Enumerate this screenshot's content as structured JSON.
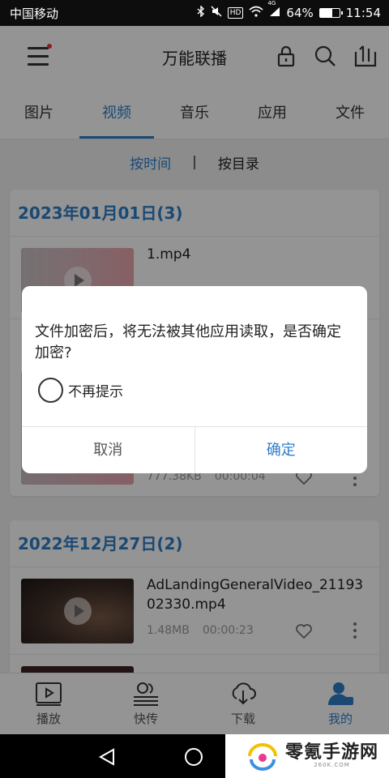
{
  "status_bar": {
    "carrier": "中国移动",
    "network_badge": "HD",
    "signal_label": "4G",
    "battery_percent": "64%",
    "battery_level": 0.64,
    "time": "11:54",
    "icons": [
      "bluetooth-icon",
      "mute-icon",
      "wifi-icon",
      "signal-icon",
      "battery-icon"
    ]
  },
  "app_bar": {
    "title": "万能联播",
    "icons": [
      "menu-icon",
      "lock-icon",
      "search-icon",
      "share-icon"
    ]
  },
  "tabs": [
    {
      "label": "图片",
      "active": false
    },
    {
      "label": "视频",
      "active": true
    },
    {
      "label": "音乐",
      "active": false
    },
    {
      "label": "应用",
      "active": false
    },
    {
      "label": "文件",
      "active": false
    }
  ],
  "sort": {
    "by_time": "按时间",
    "separator": "|",
    "by_directory": "按目录",
    "selected": "by_time"
  },
  "groups": [
    {
      "header": "2023年01月01日(3)",
      "items": [
        {
          "name": "1.mp4",
          "size": "",
          "duration": ""
        },
        {
          "name": "",
          "size": "777.38KB",
          "duration": "00:00:04"
        }
      ]
    },
    {
      "header": "2022年12月27日(2)",
      "items": [
        {
          "name": "AdLandingGeneralVideo_2119302330.mp4",
          "size": "1.48MB",
          "duration": "00:00:23"
        }
      ]
    }
  ],
  "bottom_nav": [
    {
      "label": "播放",
      "icon": "play-icon",
      "active": false
    },
    {
      "label": "快传",
      "icon": "transfer-icon",
      "active": false
    },
    {
      "label": "下载",
      "icon": "download-icon",
      "active": false
    },
    {
      "label": "我的",
      "icon": "profile-icon",
      "active": true
    }
  ],
  "dialog": {
    "message": "文件加密后，将无法被其他应用读取，是否确定加密?",
    "checkbox_label": "不再提示",
    "cancel": "取消",
    "confirm": "确定"
  },
  "watermark": {
    "text": "零氪手游网",
    "sub": "260K.COM"
  },
  "colors": {
    "accent": "#2d7fc8",
    "text": "#222222",
    "muted": "#999999"
  }
}
